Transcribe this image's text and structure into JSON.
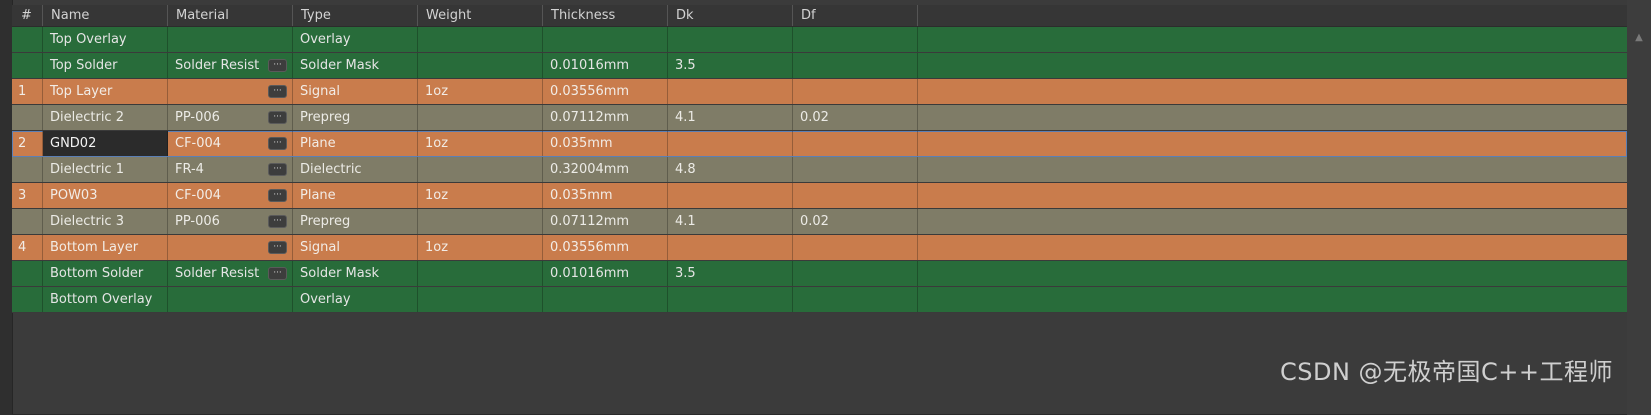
{
  "columns": {
    "num": "#",
    "name": "Name",
    "material": "Material",
    "type": "Type",
    "weight": "Weight",
    "thickness": "Thickness",
    "dk": "Dk",
    "df": "Df"
  },
  "rows": [
    {
      "num": "",
      "name": "Top Overlay",
      "material": "",
      "type": "Overlay",
      "weight": "",
      "thickness": "",
      "dk": "",
      "df": "",
      "color": "green",
      "has_button": false
    },
    {
      "num": "",
      "name": "Top Solder",
      "material": "Solder Resist",
      "type": "Solder Mask",
      "weight": "",
      "thickness": "0.01016mm",
      "dk": "3.5",
      "df": "",
      "color": "green",
      "has_button": true
    },
    {
      "num": "1",
      "name": "Top Layer",
      "material": "",
      "type": "Signal",
      "weight": "1oz",
      "thickness": "0.03556mm",
      "dk": "",
      "df": "",
      "color": "orange",
      "has_button": true
    },
    {
      "num": "",
      "name": "Dielectric 2",
      "material": "PP-006",
      "type": "Prepreg",
      "weight": "",
      "thickness": "0.07112mm",
      "dk": "4.1",
      "df": "0.02",
      "color": "gray",
      "has_button": true
    },
    {
      "num": "2",
      "name": "GND02",
      "material": "CF-004",
      "type": "Plane",
      "weight": "1oz",
      "thickness": "0.035mm",
      "dk": "",
      "df": "",
      "color": "orange",
      "has_button": true,
      "selected": true
    },
    {
      "num": "",
      "name": "Dielectric 1",
      "material": "FR-4",
      "type": "Dielectric",
      "weight": "",
      "thickness": "0.32004mm",
      "dk": "4.8",
      "df": "",
      "color": "gray",
      "has_button": true
    },
    {
      "num": "3",
      "name": "POW03",
      "material": "CF-004",
      "type": "Plane",
      "weight": "1oz",
      "thickness": "0.035mm",
      "dk": "",
      "df": "",
      "color": "orange",
      "has_button": true
    },
    {
      "num": "",
      "name": "Dielectric 3",
      "material": "PP-006",
      "type": "Prepreg",
      "weight": "",
      "thickness": "0.07112mm",
      "dk": "4.1",
      "df": "0.02",
      "color": "gray",
      "has_button": true
    },
    {
      "num": "4",
      "name": "Bottom Layer",
      "material": "",
      "type": "Signal",
      "weight": "1oz",
      "thickness": "0.03556mm",
      "dk": "",
      "df": "",
      "color": "orange",
      "has_button": true
    },
    {
      "num": "",
      "name": "Bottom Solder",
      "material": "Solder Resist",
      "type": "Solder Mask",
      "weight": "",
      "thickness": "0.01016mm",
      "dk": "3.5",
      "df": "",
      "color": "green",
      "has_button": true
    },
    {
      "num": "",
      "name": "Bottom Overlay",
      "material": "",
      "type": "Overlay",
      "weight": "",
      "thickness": "",
      "dk": "",
      "df": "",
      "color": "green",
      "has_button": false
    }
  ],
  "button_glyph": "···",
  "watermark": "CSDN @无极帝国C++工程师",
  "colors": {
    "green": "#286c3a",
    "orange": "#c97c4c",
    "gray": "#7f7c67",
    "background": "#3b3b3b",
    "selection_outline": "#5b7fb5"
  },
  "icons": {
    "scroll_up": "chevron-up-icon"
  }
}
